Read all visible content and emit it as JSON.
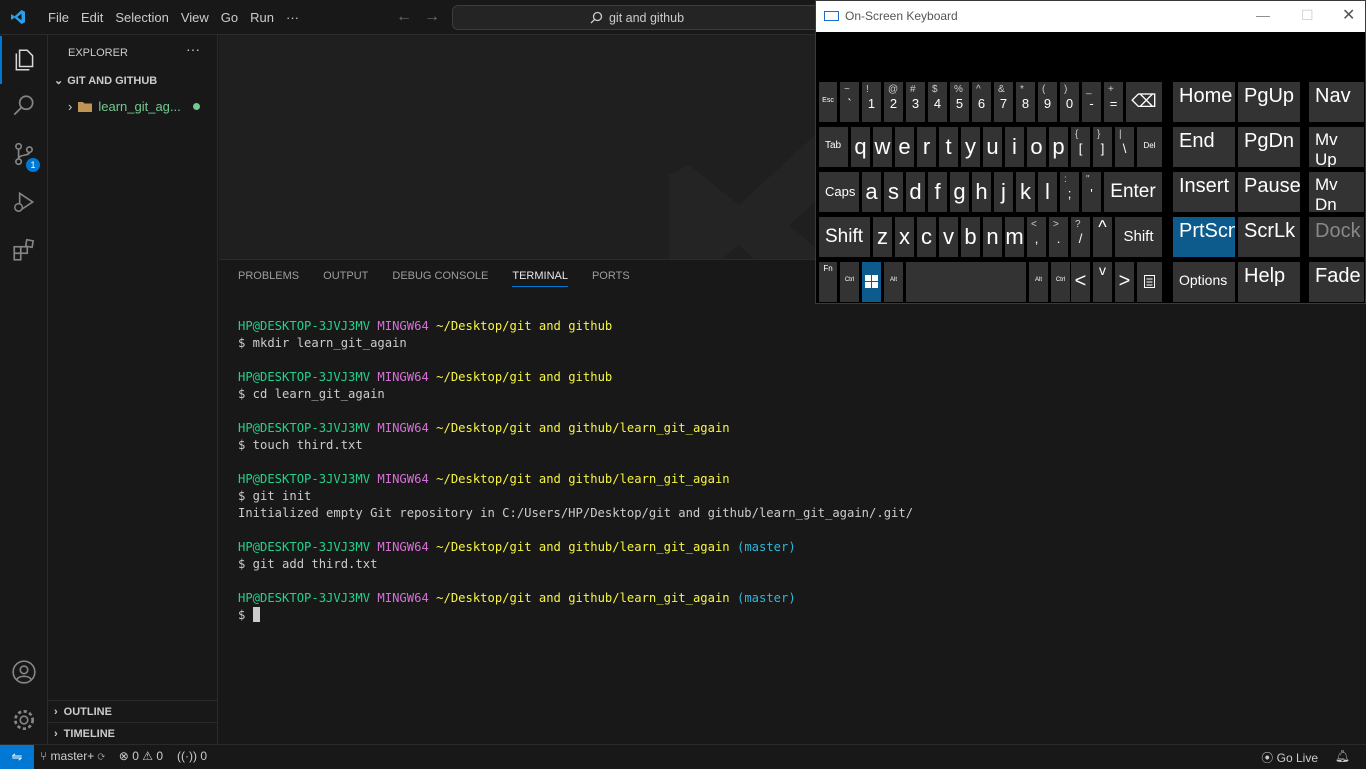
{
  "titlebar": {
    "menu": [
      "File",
      "Edit",
      "Selection",
      "View",
      "Go",
      "Run",
      "···"
    ],
    "command_center": "git and github"
  },
  "activity_bar": {
    "source_control_badge": "1"
  },
  "explorer": {
    "title": "EXPLORER",
    "more": "···",
    "workspace": "GIT AND GITHUB",
    "folder": "learn_git_ag...",
    "outline": "OUTLINE",
    "timeline": "TIMELINE"
  },
  "panel": {
    "tabs": [
      "PROBLEMS",
      "OUTPUT",
      "DEBUG CONSOLE",
      "TERMINAL",
      "PORTS"
    ],
    "active_tab": "TERMINAL"
  },
  "terminal": {
    "user": "HP@DESKTOP-3JVJ3MV",
    "shell": "MINGW64",
    "path1": "~/Desktop/git and github",
    "path2": "~/Desktop/git and github/learn_git_again",
    "branch": "(master)",
    "cmd1": "$ mkdir learn_git_again",
    "cmd2": "$ cd learn_git_again",
    "cmd3": "$ touch third.txt",
    "cmd4": "$ git init",
    "out4": "Initialized empty Git repository in C:/Users/HP/Desktop/git and github/learn_git_again/.git/",
    "cmd5": "$ git add third.txt",
    "prompt": "$ "
  },
  "statusbar": {
    "branch": "master+",
    "errors": "0",
    "warnings": "0",
    "ports": "0",
    "go_live": "Go Live"
  },
  "osk": {
    "title": "On-Screen Keyboard",
    "keys": {
      "esc": "Esc",
      "backtick": "`",
      "backtick_shift": "~",
      "n1": "1",
      "n1s": "!",
      "n2": "2",
      "n2s": "@",
      "n3": "3",
      "n3s": "#",
      "n4": "4",
      "n4s": "$",
      "n5": "5",
      "n5s": "%",
      "n6": "6",
      "n6s": "^",
      "n7": "7",
      "n7s": "&",
      "n8": "8",
      "n8s": "*",
      "n9": "9",
      "n9s": "(",
      "n0": "0",
      "n0s": ")",
      "minus": "-",
      "minus_s": "_",
      "equals": "=",
      "equals_s": "+",
      "backspace": "⌫",
      "tab": "Tab",
      "q": "q",
      "w": "w",
      "e": "e",
      "r": "r",
      "t": "t",
      "y": "y",
      "u": "u",
      "i": "i",
      "o": "o",
      "p": "p",
      "lbracket": "[",
      "lbracket_s": "{",
      "rbracket": "]",
      "rbracket_s": "}",
      "backslash": "\\",
      "backslash_s": "|",
      "del": "Del",
      "caps": "Caps",
      "a": "a",
      "s": "s",
      "d": "d",
      "f": "f",
      "g": "g",
      "h": "h",
      "j": "j",
      "k": "k",
      "l": "l",
      "semicolon": ";",
      "semicolon_s": ":",
      "quote": "'",
      "quote_s": "\"",
      "enter": "Enter",
      "shift": "Shift",
      "z": "z",
      "x": "x",
      "c": "c",
      "v": "v",
      "b": "b",
      "n": "n",
      "m": "m",
      "comma": ",",
      "comma_s": "<",
      "period": ".",
      "period_s": ">",
      "slash": "/",
      "slash_s": "?",
      "up": "^",
      "fn": "Fn",
      "ctrl": "Ctrl",
      "alt": "Alt",
      "left": "<",
      "down": "v",
      "right": ">",
      "home": "Home",
      "pgup": "PgUp",
      "nav": "Nav",
      "end": "End",
      "pgdn": "PgDn",
      "mvup": "Mv Up",
      "insert": "Insert",
      "pause": "Pause",
      "mvdn": "Mv Dn",
      "prtscn": "PrtScn",
      "scrlk": "ScrLk",
      "dock": "Dock",
      "options": "Options",
      "help": "Help",
      "fade": "Fade"
    }
  }
}
